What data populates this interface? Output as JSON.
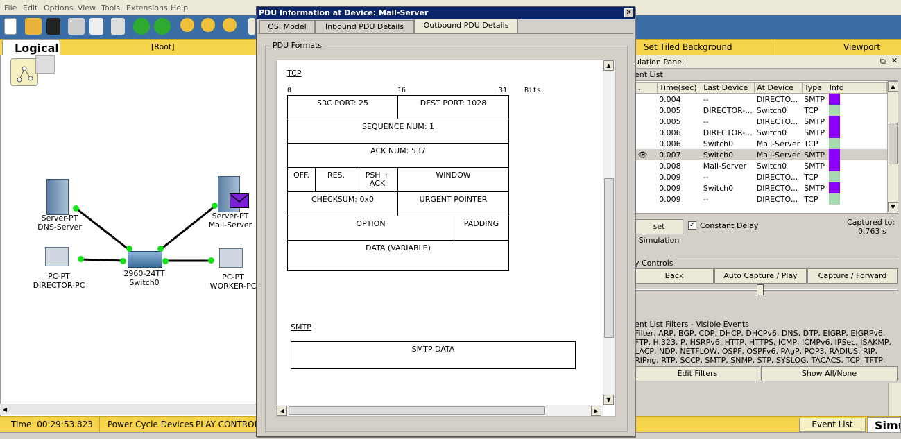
{
  "menu": [
    "File",
    "Edit",
    "Options",
    "View",
    "Tools",
    "Extensions",
    "Help"
  ],
  "logical": {
    "tab_label": "Logical",
    "root": "[Root]",
    "set_tiled": "Set Tiled Background",
    "viewport": "Viewport"
  },
  "devices": {
    "dns": {
      "type": "Server-PT",
      "name": "DNS-Server"
    },
    "mail": {
      "type": "Server-PT",
      "name": "Mail-Server"
    },
    "director": {
      "type": "PC-PT",
      "name": "DIRECTOR-PC"
    },
    "switch": {
      "type": "2960-24TT",
      "name": "Switch0"
    },
    "worker": {
      "type": "PC-PT",
      "name": "WORKER-PC"
    }
  },
  "status": {
    "time": "Time: 00:29:53.823",
    "power": "Power Cycle Devices",
    "play": "PLAY CONTROL",
    "event_list": "Event List",
    "simu": "Simu"
  },
  "sim": {
    "title": "ulation Panel",
    "event_list_label": "ent List",
    "columns": [
      ".",
      "Time(sec)",
      "Last Device",
      "At Device",
      "Type",
      "Info"
    ],
    "rows": [
      {
        "eye": "",
        "time": "0.004",
        "last": "--",
        "at": "DIRECTO...",
        "type": "SMTP",
        "color": "#8b00ff"
      },
      {
        "eye": "",
        "time": "0.005",
        "last": "DIRECTOR-...",
        "at": "Switch0",
        "type": "TCP",
        "color": "#a8dcb0"
      },
      {
        "eye": "",
        "time": "0.005",
        "last": "--",
        "at": "DIRECTO...",
        "type": "SMTP",
        "color": "#8b00ff"
      },
      {
        "eye": "",
        "time": "0.006",
        "last": "DIRECTOR-...",
        "at": "Switch0",
        "type": "SMTP",
        "color": "#8b00ff"
      },
      {
        "eye": "",
        "time": "0.006",
        "last": "Switch0",
        "at": "Mail-Server",
        "type": "TCP",
        "color": "#a8dcb0"
      },
      {
        "eye": "👁",
        "time": "0.007",
        "last": "Switch0",
        "at": "Mail-Server",
        "type": "SMTP",
        "color": "#8b00ff"
      },
      {
        "eye": "",
        "time": "0.008",
        "last": "Mail-Server",
        "at": "Switch0",
        "type": "SMTP",
        "color": "#8b00ff"
      },
      {
        "eye": "",
        "time": "0.009",
        "last": "--",
        "at": "DIRECTO...",
        "type": "TCP",
        "color": "#a8dcb0"
      },
      {
        "eye": "",
        "time": "0.009",
        "last": "Switch0",
        "at": "DIRECTO...",
        "type": "SMTP",
        "color": "#8b00ff"
      },
      {
        "eye": "",
        "time": "0.009",
        "last": "--",
        "at": "DIRECTO...",
        "type": "TCP",
        "color": "#a8dcb0"
      }
    ],
    "reset": "set Simulation",
    "constant_delay": "Constant Delay",
    "captured_to": "Captured to:",
    "captured_val": "0.763 s",
    "play_controls": "y Controls",
    "back": "Back",
    "auto_capture": "Auto Capture / Play",
    "capture_forward": "Capture / Forward",
    "filters_label": "ent List Filters - Visible Events",
    "filters_text": "Filter, ARP, BGP, CDP, DHCP, DHCPv6, DNS, DTP, EIGRP, EIGRPv6, FTP, H.323, P, HSRPv6, HTTP, HTTPS, ICMP, ICMPv6, IPSec, ISAKMP, LACP, NDP, NETFLOW, OSPF, OSPFv6, PAgP, POP3, RADIUS, RIP, RIPng, RTP, SCCP, SMTP, SNMP, STP, SYSLOG, TACACS, TCP, TFTP, Telnet, UDP, VTP",
    "edit_filters": "Edit Filters",
    "show_all": "Show All/None"
  },
  "dialog": {
    "title": "PDU Information at Device: Mail-Server",
    "tabs": [
      "OSI Model",
      "Inbound PDU Details",
      "Outbound PDU Details"
    ],
    "formats_label": "PDU Formats",
    "tcp_label": "TCP",
    "bits": {
      "b0": "0",
      "b16": "16",
      "b31": "31",
      "bits": "Bits"
    },
    "tcp": {
      "src": "SRC PORT: 25",
      "dest": "DEST PORT: 1028",
      "seq": "SEQUENCE NUM: 1",
      "ack": "ACK NUM: 537",
      "off": "OFF.",
      "res": "RES.",
      "flags": "PSH + ACK",
      "window": "WINDOW",
      "checksum": "CHECKSUM: 0x0",
      "urgent": "URGENT POINTER",
      "option": "OPTION",
      "padding": "PADDING",
      "data": "DATA (VARIABLE)"
    },
    "smtp_label": "SMTP",
    "smtp_data": "SMTP DATA"
  }
}
